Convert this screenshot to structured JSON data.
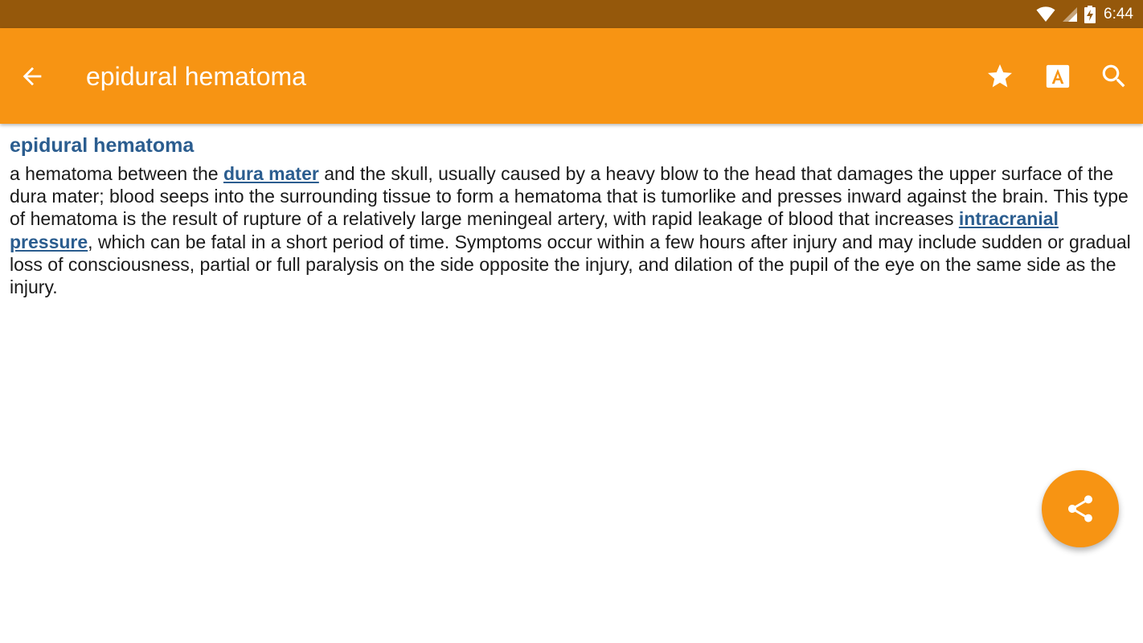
{
  "status_bar": {
    "time": "6:44",
    "icons": [
      "wifi-icon",
      "cell-signal-icon",
      "battery-charging-icon"
    ]
  },
  "app_bar": {
    "title": "epidural hematoma",
    "back_icon": "arrow-back-icon",
    "actions": [
      "star-icon",
      "font-size-icon",
      "search-icon"
    ]
  },
  "colors": {
    "status_bar": "#95580b",
    "app_bar": "#f79413",
    "accent": "#f79413",
    "link": "#2b5d8f"
  },
  "entry": {
    "title": "epidural hematoma",
    "text_1": "a hematoma between the ",
    "link_1": "dura mater",
    "text_2": " and the skull, usually caused by a heavy blow to the head that damages the upper surface of the dura mater; blood seeps into the surrounding tissue to form a hematoma that is tumorlike and presses inward against the brain. This type of hematoma is the result of rupture of a relatively large meningeal artery, with rapid leakage of blood that increases ",
    "link_2": "intracranial pressure",
    "text_3": ", which can be fatal in a short period of time. Symptoms occur within a few hours after injury and may include sudden or gradual loss of consciousness, partial or full paralysis on the side opposite the injury, and dilation of the pupil of the eye on the same side as the injury."
  },
  "fab": {
    "icon": "share-icon"
  }
}
